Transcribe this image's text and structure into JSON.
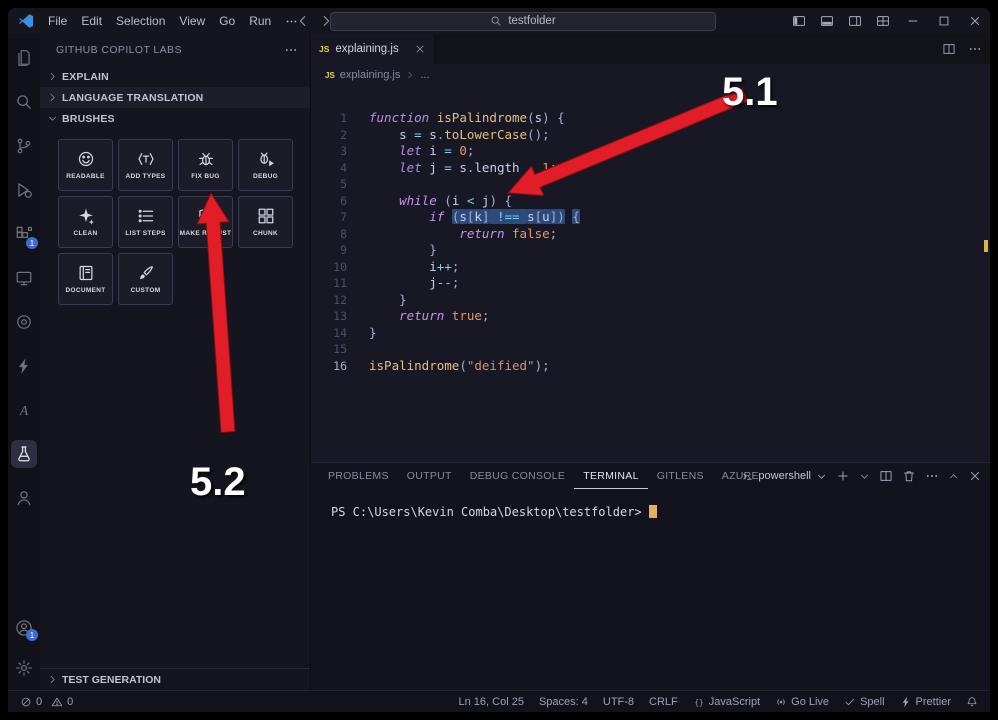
{
  "window": {
    "menus": [
      "File",
      "Edit",
      "Selection",
      "View",
      "Go",
      "Run"
    ],
    "search_value": "testfolder"
  },
  "activity_bar": {
    "top": [
      {
        "name": "explorer",
        "icon": "files"
      },
      {
        "name": "search",
        "icon": "search"
      },
      {
        "name": "source-control",
        "icon": "git"
      },
      {
        "name": "run-and-debug",
        "icon": "debug"
      },
      {
        "name": "extensions",
        "icon": "ext",
        "badge": "1"
      },
      {
        "name": "remote-explorer",
        "icon": "monitor"
      },
      {
        "name": "live-server",
        "icon": "circle"
      },
      {
        "name": "thunder-client",
        "icon": "bolt"
      },
      {
        "name": "azure",
        "icon": "azure"
      },
      {
        "name": "copilot-labs",
        "icon": "beaker",
        "active": true
      },
      {
        "name": "people",
        "icon": "person"
      }
    ],
    "bottom": [
      {
        "name": "accounts",
        "icon": "account",
        "badge": "1"
      },
      {
        "name": "settings",
        "icon": "gear"
      }
    ]
  },
  "sidebar": {
    "title": "GITHUB COPILOT LABS",
    "sections": {
      "explain": "EXPLAIN",
      "language_translation": "LANGUAGE TRANSLATION",
      "brushes": "BRUSHES",
      "test_generation": "TEST GENERATION"
    },
    "brushes": [
      {
        "label": "READABLE",
        "icon": "smiley"
      },
      {
        "label": "ADD TYPES",
        "icon": "types"
      },
      {
        "label": "FIX BUG",
        "icon": "bug"
      },
      {
        "label": "DEBUG",
        "icon": "debugalt"
      },
      {
        "label": "CLEAN",
        "icon": "sparkle"
      },
      {
        "label": "LIST STEPS",
        "icon": "list"
      },
      {
        "label": "MAKE ROBUST",
        "icon": "shield"
      },
      {
        "label": "CHUNK",
        "icon": "chunk"
      },
      {
        "label": "DOCUMENT",
        "icon": "book"
      },
      {
        "label": "CUSTOM",
        "icon": "paint"
      }
    ]
  },
  "editor": {
    "tab": "explaining.js",
    "tab_icon": "JS",
    "breadcrumb": "explaining.js",
    "breadcrumb_more": "...",
    "code": [
      {
        "n": "1",
        "tokens": [
          [
            "dec",
            "function"
          ],
          [
            "pl",
            " "
          ],
          [
            "fn",
            "isPalindrome"
          ],
          [
            "pl",
            "("
          ],
          [
            "va",
            "s"
          ],
          [
            "pl",
            ") {"
          ]
        ]
      },
      {
        "n": "2",
        "tokens": [
          [
            "pl",
            "    "
          ],
          [
            "va",
            "s"
          ],
          [
            "op",
            " = "
          ],
          [
            "va",
            "s"
          ],
          [
            "pl",
            "."
          ],
          [
            "fn",
            "toLowerCase"
          ],
          [
            "pl",
            "();"
          ]
        ]
      },
      {
        "n": "3",
        "tokens": [
          [
            "pl",
            "    "
          ],
          [
            "dec",
            "let"
          ],
          [
            "pl",
            " "
          ],
          [
            "va",
            "i"
          ],
          [
            "op",
            " = "
          ],
          [
            "nu",
            "0"
          ],
          [
            "pl",
            ";"
          ]
        ]
      },
      {
        "n": "4",
        "tokens": [
          [
            "pl",
            "    "
          ],
          [
            "dec",
            "let"
          ],
          [
            "pl",
            " "
          ],
          [
            "va",
            "j"
          ],
          [
            "op",
            " = "
          ],
          [
            "va",
            "s"
          ],
          [
            "pl",
            "."
          ],
          [
            "va",
            "length"
          ],
          [
            "op",
            " - "
          ],
          [
            "nu",
            "1"
          ],
          [
            "pl",
            ";"
          ]
        ]
      },
      {
        "n": "5",
        "tokens": []
      },
      {
        "n": "6",
        "tokens": [
          [
            "pl",
            "    "
          ],
          [
            "ctl",
            "while"
          ],
          [
            "pl",
            " ("
          ],
          [
            "va",
            "i"
          ],
          [
            "op",
            " < "
          ],
          [
            "va",
            "j"
          ],
          [
            "pl",
            ") {"
          ]
        ]
      },
      {
        "n": "7",
        "tokens": [
          [
            "pl",
            "        "
          ],
          [
            "ctl",
            "if"
          ],
          [
            "pl",
            " "
          ],
          [
            "pl sel",
            "("
          ],
          [
            "va sel",
            "s"
          ],
          [
            "pl sel",
            "["
          ],
          [
            "va sel",
            "k"
          ],
          [
            "pl sel",
            "]"
          ],
          [
            "op sel",
            " !== "
          ],
          [
            "va sel",
            "s"
          ],
          [
            "pl sel",
            "["
          ],
          [
            "va sel",
            "u"
          ],
          [
            "pl sel",
            "])"
          ],
          [
            "pl",
            " "
          ],
          [
            "pl sel",
            "{"
          ]
        ]
      },
      {
        "n": "8",
        "tokens": [
          [
            "pl",
            "            "
          ],
          [
            "ctl",
            "return"
          ],
          [
            "pl",
            " "
          ],
          [
            "nu",
            "false"
          ],
          [
            "pl",
            ";"
          ]
        ]
      },
      {
        "n": "9",
        "tokens": [
          [
            "pl",
            "        "
          ],
          [
            "pl",
            "}"
          ]
        ]
      },
      {
        "n": "10",
        "tokens": [
          [
            "pl",
            "        "
          ],
          [
            "va",
            "i"
          ],
          [
            "op",
            "++"
          ],
          [
            "pl",
            ";"
          ]
        ]
      },
      {
        "n": "11",
        "tokens": [
          [
            "pl",
            "        "
          ],
          [
            "va",
            "j"
          ],
          [
            "op",
            "--"
          ],
          [
            "pl",
            ";"
          ]
        ]
      },
      {
        "n": "12",
        "tokens": [
          [
            "pl",
            "    "
          ],
          [
            "pl",
            "}"
          ]
        ]
      },
      {
        "n": "13",
        "tokens": [
          [
            "pl",
            "    "
          ],
          [
            "ctl",
            "return"
          ],
          [
            "pl",
            " "
          ],
          [
            "nu",
            "true"
          ],
          [
            "pl",
            ";"
          ]
        ]
      },
      {
        "n": "14",
        "tokens": [
          [
            "pl",
            "}"
          ]
        ]
      },
      {
        "n": "15",
        "tokens": []
      },
      {
        "n": "16",
        "active": true,
        "tokens": [
          [
            "fn",
            "isPalindrome"
          ],
          [
            "pl",
            "("
          ],
          [
            "st",
            "\"deified\""
          ],
          [
            "pl",
            ");"
          ]
        ]
      }
    ]
  },
  "panel": {
    "tabs": [
      "PROBLEMS",
      "OUTPUT",
      "DEBUG CONSOLE",
      "TERMINAL",
      "GITLENS",
      "AZURE"
    ],
    "active": "TERMINAL",
    "shell_label": "powershell",
    "terminal_prompt": "PS C:\\Users\\Kevin Comba\\Desktop\\testfolder>"
  },
  "status_bar": {
    "errors": "0",
    "warnings": "0",
    "items": [
      {
        "label": "Ln 16, Col 25"
      },
      {
        "label": "Spaces: 4"
      },
      {
        "label": "UTF-8"
      },
      {
        "label": "CRLF"
      },
      {
        "icon": "braces",
        "label": "JavaScript"
      },
      {
        "icon": "broadcast",
        "label": "Go Live"
      },
      {
        "icon": "check",
        "label": "Spell"
      },
      {
        "icon": "bolt",
        "label": "Prettier"
      },
      {
        "icon": "bell",
        "label": ""
      }
    ]
  },
  "annotations": {
    "step1": "5.1",
    "step2": "5.2"
  }
}
